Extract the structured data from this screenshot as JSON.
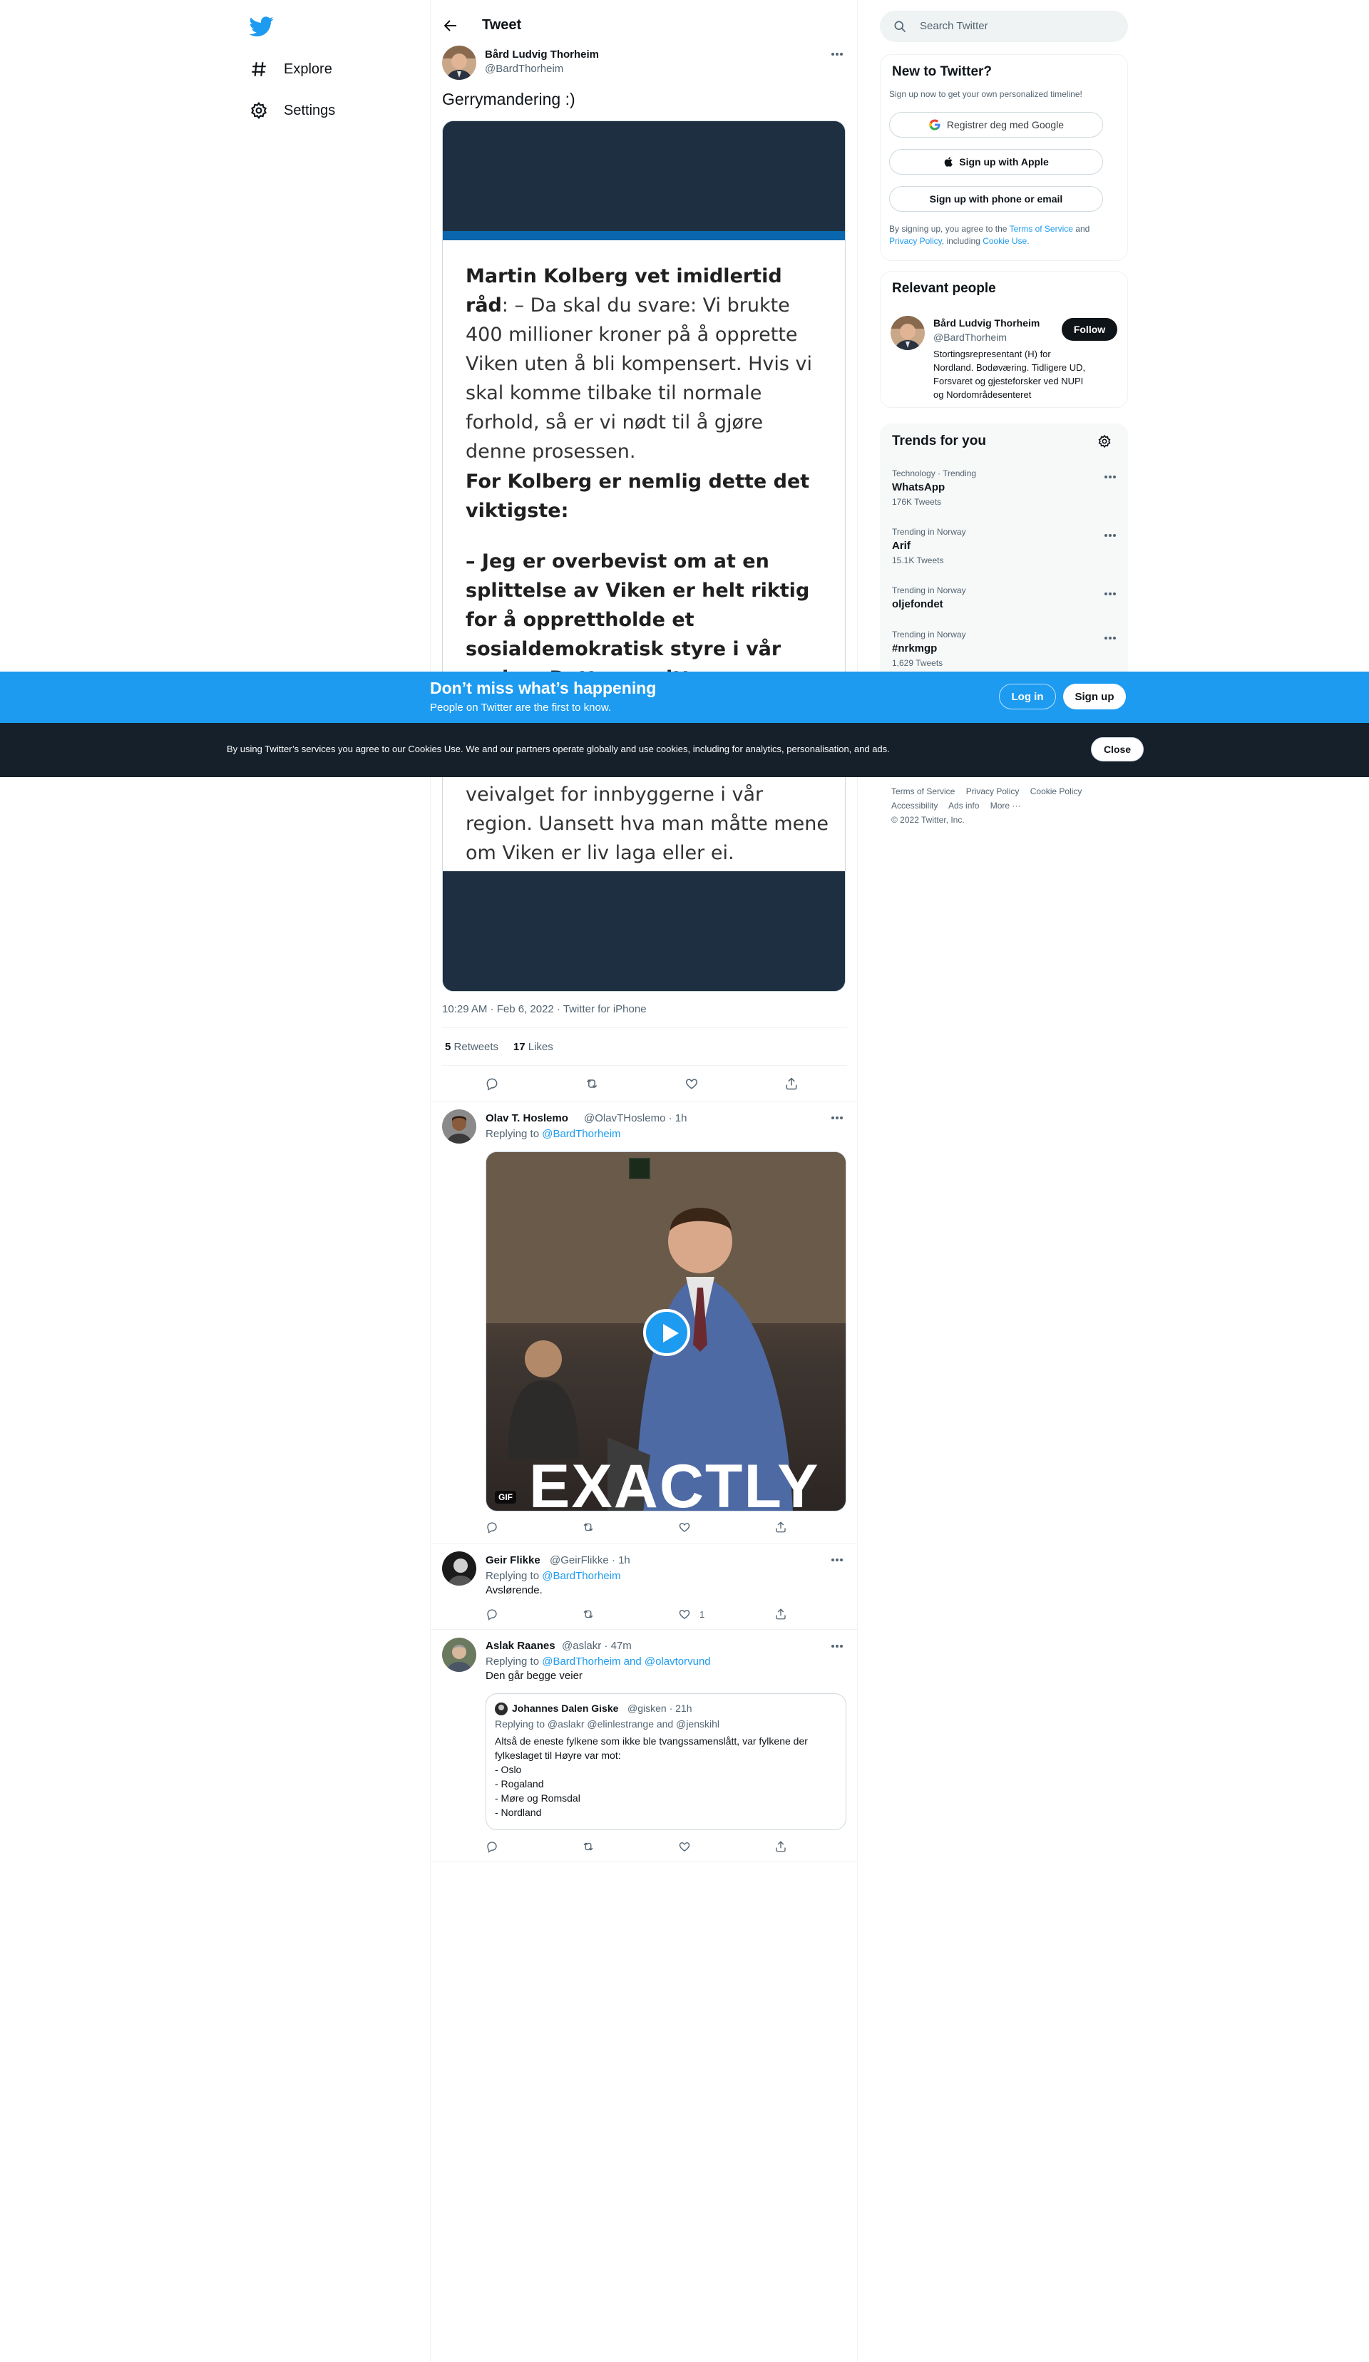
{
  "nav": {
    "explore": "Explore",
    "settings": "Settings"
  },
  "header": {
    "title": "Tweet"
  },
  "tweet": {
    "author": "Bård Ludvig Thorheim",
    "handle": "@BardThorheim",
    "text": "Gerrymandering :)",
    "image": {
      "p1_bold": "Martin Kolberg vet imidlertid råd",
      "p1_rest": ": – Da skal du svare: Vi brukte 400 millioner kroner på å opprette Viken uten å bli kompensert. Hvis vi skal komme tilbake til normale forhold, så er vi nødt til å gjøre denne prosessen.",
      "p2": "For Kolberg er nemlig dette det viktigste:",
      "p3": "– Jeg er overbevist om at en splittelse av Viken er helt riktig for å opprettholde et sosialdemokratisk styre i vår region. Dette er mitt hovedargument.",
      "p4": "Aps makt er det som skal bestemme veivalget for innbyggerne i vår region. Uansett hva man måtte mene om Viken er liv laga eller ei."
    },
    "meta": "10:29 AM · Feb 6, 2022 · Twitter for iPhone",
    "retweets_count": "5",
    "retweets_label": "Retweets",
    "likes_count": "17",
    "likes_label": "Likes"
  },
  "replies": [
    {
      "author": "Olav T. Hoslemo",
      "handle": "@OlavTHoslemo · 1h",
      "replying_prefix": "Replying to",
      "replying_to": "@BardThorheim",
      "gif_caption": "EXACTLY",
      "gif_badge": "GIF"
    },
    {
      "author": "Geir Flikke",
      "handle": "@GeirFlikke · 1h",
      "replying_prefix": "Replying to",
      "replying_to": "@BardThorheim",
      "text": "Avslørende.",
      "like_count": "1"
    },
    {
      "author": "Aslak Raanes",
      "handle": "@aslakr · 47m",
      "replying_prefix": "Replying to",
      "replying_to": "@BardThorheim and @olavtorvund",
      "text": "Den går begge veier",
      "quote": {
        "author": "Johannes Dalen Giske",
        "handle": "@gisken · 21h",
        "replying": "Replying to @aslakr @elinlestrange and @jenskihl",
        "line1": "Altså de eneste fylkene som ikke ble tvangssamenslått, var fylkene der",
        "line2": "fylkeslaget til Høyre var mot:",
        "line3": "- Oslo",
        "line4": "- Rogaland",
        "line5": "- Møre og Romsdal",
        "line6": "- Nordland"
      }
    }
  ],
  "search": {
    "placeholder": "Search Twitter"
  },
  "new_to_twitter": {
    "title": "New to Twitter?",
    "subtitle": "Sign up now to get your own personalized timeline!",
    "google": "Registrer deg med Google",
    "apple": "Sign up with Apple",
    "phone": "Sign up with phone or email",
    "terms1": "By signing up, you agree to the",
    "terms_link": "Terms of Service",
    "terms2": "and",
    "privacy_link": "Privacy Policy",
    "terms3": ", including",
    "cookie_link": "Cookie Use."
  },
  "relevant": {
    "title": "Relevant people",
    "name": "Bård Ludvig Thorheim",
    "handle": "@BardThorheim",
    "follow": "Follow",
    "bio1": "Stortingsrepresentant (H) for",
    "bio2": "Nordland. Bodøværing. Tidligere UD,",
    "bio3": "Forsvaret og gjesteforsker ved NUPI",
    "bio4": "og Nordområdesenteret"
  },
  "trends": {
    "title": "Trends for you",
    "items": [
      {
        "cat": "Technology · Trending",
        "name": "WhatsApp",
        "count": "176K Tweets"
      },
      {
        "cat": "Trending in Norway",
        "name": "Arif",
        "count": "15.1K Tweets"
      },
      {
        "cat": "Trending in Norway",
        "name": "oljefondet",
        "count": ""
      },
      {
        "cat": "Trending in Norway",
        "name": "#nrkmgp",
        "count": "1,629 Tweets"
      }
    ]
  },
  "footer": {
    "l1": "Terms of Service",
    "l2": "Privacy Policy",
    "l3": "Cookie Policy",
    "l4": "Accessibility",
    "l5": "Ads info",
    "l6": "More ···",
    "copyright": "© 2022 Twitter, Inc."
  },
  "signup_bar": {
    "title": "Don’t miss what’s happening",
    "subtitle": "People on Twitter are the first to know.",
    "login": "Log in",
    "signup": "Sign up"
  },
  "cookie": {
    "text": "By using Twitter’s services you agree to our Cookies Use. We and our partners operate globally and use cookies, including for analytics, personalisation, and ads.",
    "close": "Close"
  },
  "colors": {
    "accent": "#1d9bf0",
    "dark": "#0f1419",
    "muted": "#536471"
  }
}
